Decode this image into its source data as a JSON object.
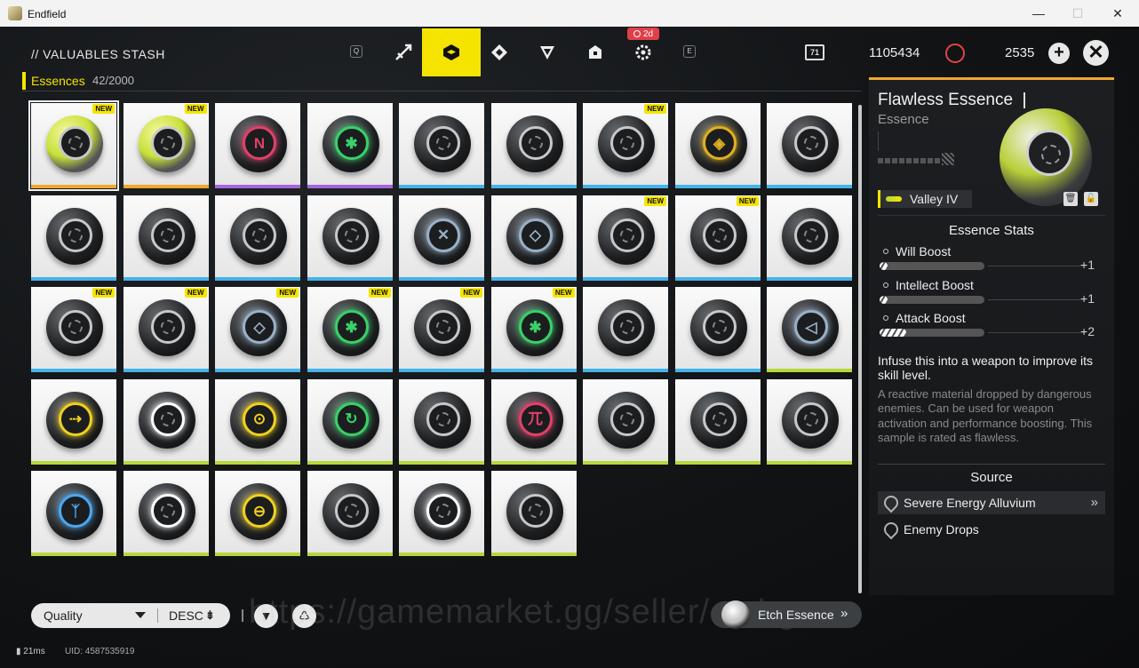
{
  "window": {
    "title": "Endfield"
  },
  "header": {
    "stash_title": "// VALUABLES STASH",
    "key_left": "Q",
    "key_right": "E",
    "tabs": [
      "weapon",
      "valuables",
      "gear",
      "material",
      "cargo",
      "module"
    ],
    "badge": "2d",
    "currency1_icon_text": "71",
    "currency1": "1105434",
    "currency2": "2535"
  },
  "category": {
    "label": "Essences",
    "count": "42/2000"
  },
  "grid": {
    "selected_index": 0,
    "items": [
      {
        "rarity": "gold",
        "new": true,
        "color": "lime",
        "glyph": ""
      },
      {
        "rarity": "gold",
        "new": true,
        "color": "lime",
        "glyph": ""
      },
      {
        "rarity": "purple",
        "new": false,
        "color": "#e0406a",
        "glyph": "N"
      },
      {
        "rarity": "purple",
        "new": false,
        "color": "#3ad06a",
        "glyph": "✱"
      },
      {
        "rarity": "blue",
        "new": false,
        "color": "",
        "glyph": ""
      },
      {
        "rarity": "blue",
        "new": false,
        "color": "",
        "glyph": ""
      },
      {
        "rarity": "blue",
        "new": true,
        "color": "",
        "glyph": ""
      },
      {
        "rarity": "blue",
        "new": false,
        "color": "#e0b020",
        "glyph": "◈"
      },
      {
        "rarity": "blue",
        "new": false,
        "color": "",
        "glyph": ""
      },
      {
        "rarity": "blue",
        "new": false,
        "color": "",
        "glyph": ""
      },
      {
        "rarity": "blue",
        "new": false,
        "color": "",
        "glyph": ""
      },
      {
        "rarity": "blue",
        "new": false,
        "color": "",
        "glyph": ""
      },
      {
        "rarity": "blue",
        "new": false,
        "color": "",
        "glyph": ""
      },
      {
        "rarity": "blue",
        "new": false,
        "color": "#9ab0c8",
        "glyph": "✕"
      },
      {
        "rarity": "blue",
        "new": false,
        "color": "#9ab0c8",
        "glyph": "◇"
      },
      {
        "rarity": "blue",
        "new": true,
        "color": "",
        "glyph": ""
      },
      {
        "rarity": "blue",
        "new": true,
        "color": "",
        "glyph": ""
      },
      {
        "rarity": "blue",
        "new": false,
        "color": "",
        "glyph": ""
      },
      {
        "rarity": "blue",
        "new": true,
        "color": "",
        "glyph": ""
      },
      {
        "rarity": "blue",
        "new": true,
        "color": "",
        "glyph": ""
      },
      {
        "rarity": "blue",
        "new": true,
        "color": "#9ab0c8",
        "glyph": "◇"
      },
      {
        "rarity": "blue",
        "new": true,
        "color": "#3ad06a",
        "glyph": "✱"
      },
      {
        "rarity": "blue",
        "new": true,
        "color": "",
        "glyph": ""
      },
      {
        "rarity": "blue",
        "new": true,
        "color": "#3ad06a",
        "glyph": "✱"
      },
      {
        "rarity": "blue",
        "new": false,
        "color": "",
        "glyph": ""
      },
      {
        "rarity": "blue",
        "new": false,
        "color": "",
        "glyph": ""
      },
      {
        "rarity": "lime",
        "new": false,
        "color": "#9ab0c8",
        "glyph": "◁"
      },
      {
        "rarity": "lime",
        "new": false,
        "color": "#f0d020",
        "glyph": "⇢"
      },
      {
        "rarity": "lime",
        "new": false,
        "color": "#ffffff",
        "glyph": ""
      },
      {
        "rarity": "lime",
        "new": false,
        "color": "#f0d020",
        "glyph": "⊙"
      },
      {
        "rarity": "lime",
        "new": false,
        "color": "#3ad06a",
        "glyph": "↻"
      },
      {
        "rarity": "lime",
        "new": false,
        "color": "",
        "glyph": ""
      },
      {
        "rarity": "lime",
        "new": false,
        "color": "#e0406a",
        "glyph": "兀"
      },
      {
        "rarity": "lime",
        "new": false,
        "color": "",
        "glyph": ""
      },
      {
        "rarity": "lime",
        "new": false,
        "color": "",
        "glyph": ""
      },
      {
        "rarity": "lime",
        "new": false,
        "color": "",
        "glyph": ""
      },
      {
        "rarity": "lime",
        "new": false,
        "color": "#4aa8f0",
        "glyph": "ᛉ"
      },
      {
        "rarity": "lime",
        "new": false,
        "color": "#ffffff",
        "glyph": ""
      },
      {
        "rarity": "lime",
        "new": false,
        "color": "#f0d020",
        "glyph": "⊖"
      },
      {
        "rarity": "lime",
        "new": false,
        "color": "",
        "glyph": ""
      },
      {
        "rarity": "lime",
        "new": false,
        "color": "#ffffff",
        "glyph": ""
      },
      {
        "rarity": "lime",
        "new": false,
        "color": "",
        "glyph": ""
      }
    ],
    "new_label": "NEW"
  },
  "bottom": {
    "sort_label": "Quality",
    "order_label": "DESC",
    "filter_icon": "filter-icon",
    "recycle_icon": "recycle-icon",
    "etch_label": "Etch Essence",
    "ping": "21ms",
    "uid": "UID: 4587535919",
    "watermark": "https://gamemarket.gg/seller/etchgonn"
  },
  "detail": {
    "name": "Flawless Essence",
    "category": "Essence",
    "location": "Valley IV",
    "stats_title": "Essence Stats",
    "stats": [
      {
        "name": "Will Boost",
        "value": "+1",
        "level": 0.08
      },
      {
        "name": "Intellect Boost",
        "value": "+1",
        "level": 0.08
      },
      {
        "name": "Attack Boost",
        "value": "+2",
        "level": 0.25
      }
    ],
    "desc_main": "Infuse this into a weapon to improve its skill level.",
    "desc_flavor": "A reactive material dropped by dangerous enemies. Can be used for weapon activation and performance boosting. This sample is rated as flawless.",
    "source_title": "Source",
    "sources": [
      "Severe Energy Alluvium",
      "Enemy Drops"
    ]
  },
  "colors": {
    "accent": "#f5e400",
    "gold": "#f0a830",
    "purple": "#a565e0",
    "blue": "#46b3ea",
    "lime": "#b7d83a"
  }
}
